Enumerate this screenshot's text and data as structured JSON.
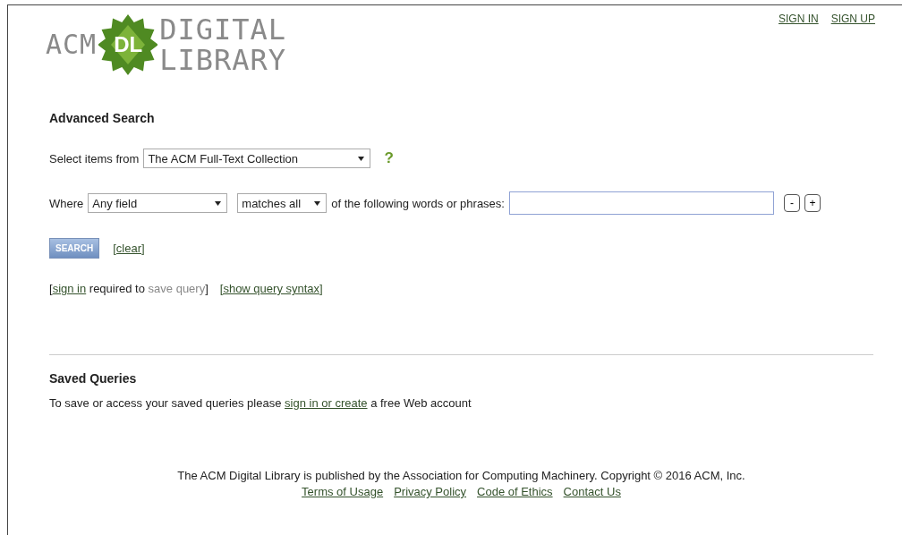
{
  "header": {
    "logo": {
      "left": "ACM",
      "badge": "DL",
      "top": "DIGITAL",
      "bottom": "LIBRARY"
    },
    "account_links": [
      "SIGN IN",
      "SIGN UP"
    ]
  },
  "advanced_search": {
    "title": "Advanced Search",
    "collection_row": {
      "label": "Select items from",
      "select": "The ACM Full-Text Collection",
      "help": "?"
    },
    "criteria_row": {
      "label": "Where",
      "field_select": "Any field",
      "match_select": "matches all",
      "after": "of the following words or phrases:",
      "buttons": [
        "-",
        "+"
      ]
    },
    "search_button": "SEARCH",
    "clear_link": "[clear]",
    "note": {
      "open": "[",
      "link": "sign in",
      "middle": " required to ",
      "disabled": "save query",
      "close": "]"
    },
    "syntax_link": "[show query syntax]"
  },
  "saved_queries": {
    "title": "Saved Queries",
    "text_before": "To save or access your saved queries please ",
    "link": "sign in or create",
    "text_after": " a free Web account"
  },
  "footer": {
    "text": "The ACM Digital Library is published by the Association for Computing Machinery. Copyright © 2016 ACM, Inc.",
    "links": [
      "Terms of Usage",
      "Privacy Policy",
      "Code of Ethics",
      "Contact Us"
    ]
  }
}
